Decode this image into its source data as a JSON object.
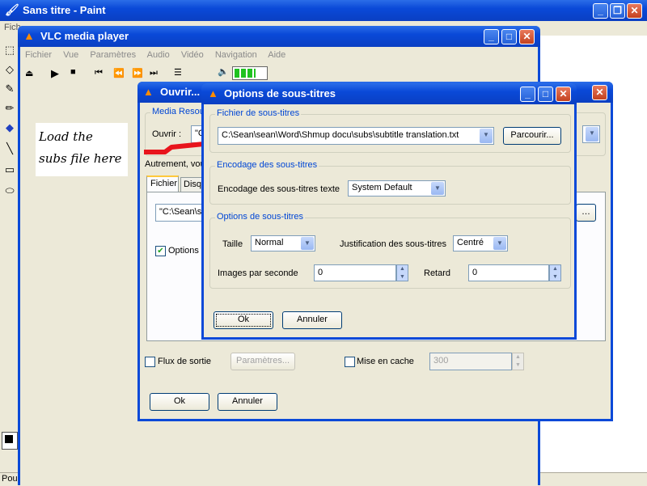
{
  "paint": {
    "title": "Sans titre - Paint",
    "menu_first": "Fich",
    "status": "Pour",
    "note": "Load the subs file here"
  },
  "vlc": {
    "title": "VLC media player",
    "menu": [
      "Fichier",
      "Vue",
      "Paramètres",
      "Audio",
      "Vidéo",
      "Navigation",
      "Aide"
    ]
  },
  "open_dialog": {
    "title": "Ouvrir...",
    "media_group": "Media Resour",
    "open_label": "Ouvrir :",
    "open_value": "\"C",
    "alt_text": "Autrement, vou",
    "tabs": [
      "Fichier",
      "Disq"
    ],
    "file_value": "\"C:\\Sean\\s",
    "options_label": "Options d",
    "stream_label": "Flux de sortie",
    "params_button": "Paramètres...",
    "cache_label": "Mise en cache",
    "cache_value": "300",
    "ok": "Ok",
    "cancel": "Annuler"
  },
  "sub_dialog": {
    "title": "Options de sous-titres",
    "file_group": "Fichier de sous-titres",
    "file_path": "C:\\Sean\\sean\\Word\\Shmup docu\\subs\\subtitle translation.txt",
    "browse_button": "Parcourir...",
    "encoding_group": "Encodage des sous-titres",
    "encoding_label": "Encodage des sous-titres texte",
    "encoding_value": "System Default",
    "options_group": "Options de sous-titres",
    "size_label": "Taille",
    "size_value": "Normal",
    "justify_label": "Justification des sous-titres",
    "justify_value": "Centré",
    "fps_label": "Images par seconde",
    "fps_value": "0",
    "delay_label": "Retard",
    "delay_value": "0",
    "ok": "Ok",
    "cancel": "Annuler"
  },
  "colors": {
    "title_blue": "#0a49d8",
    "dialog_bg": "#ece9d8",
    "arrow_red": "#e8141c"
  }
}
